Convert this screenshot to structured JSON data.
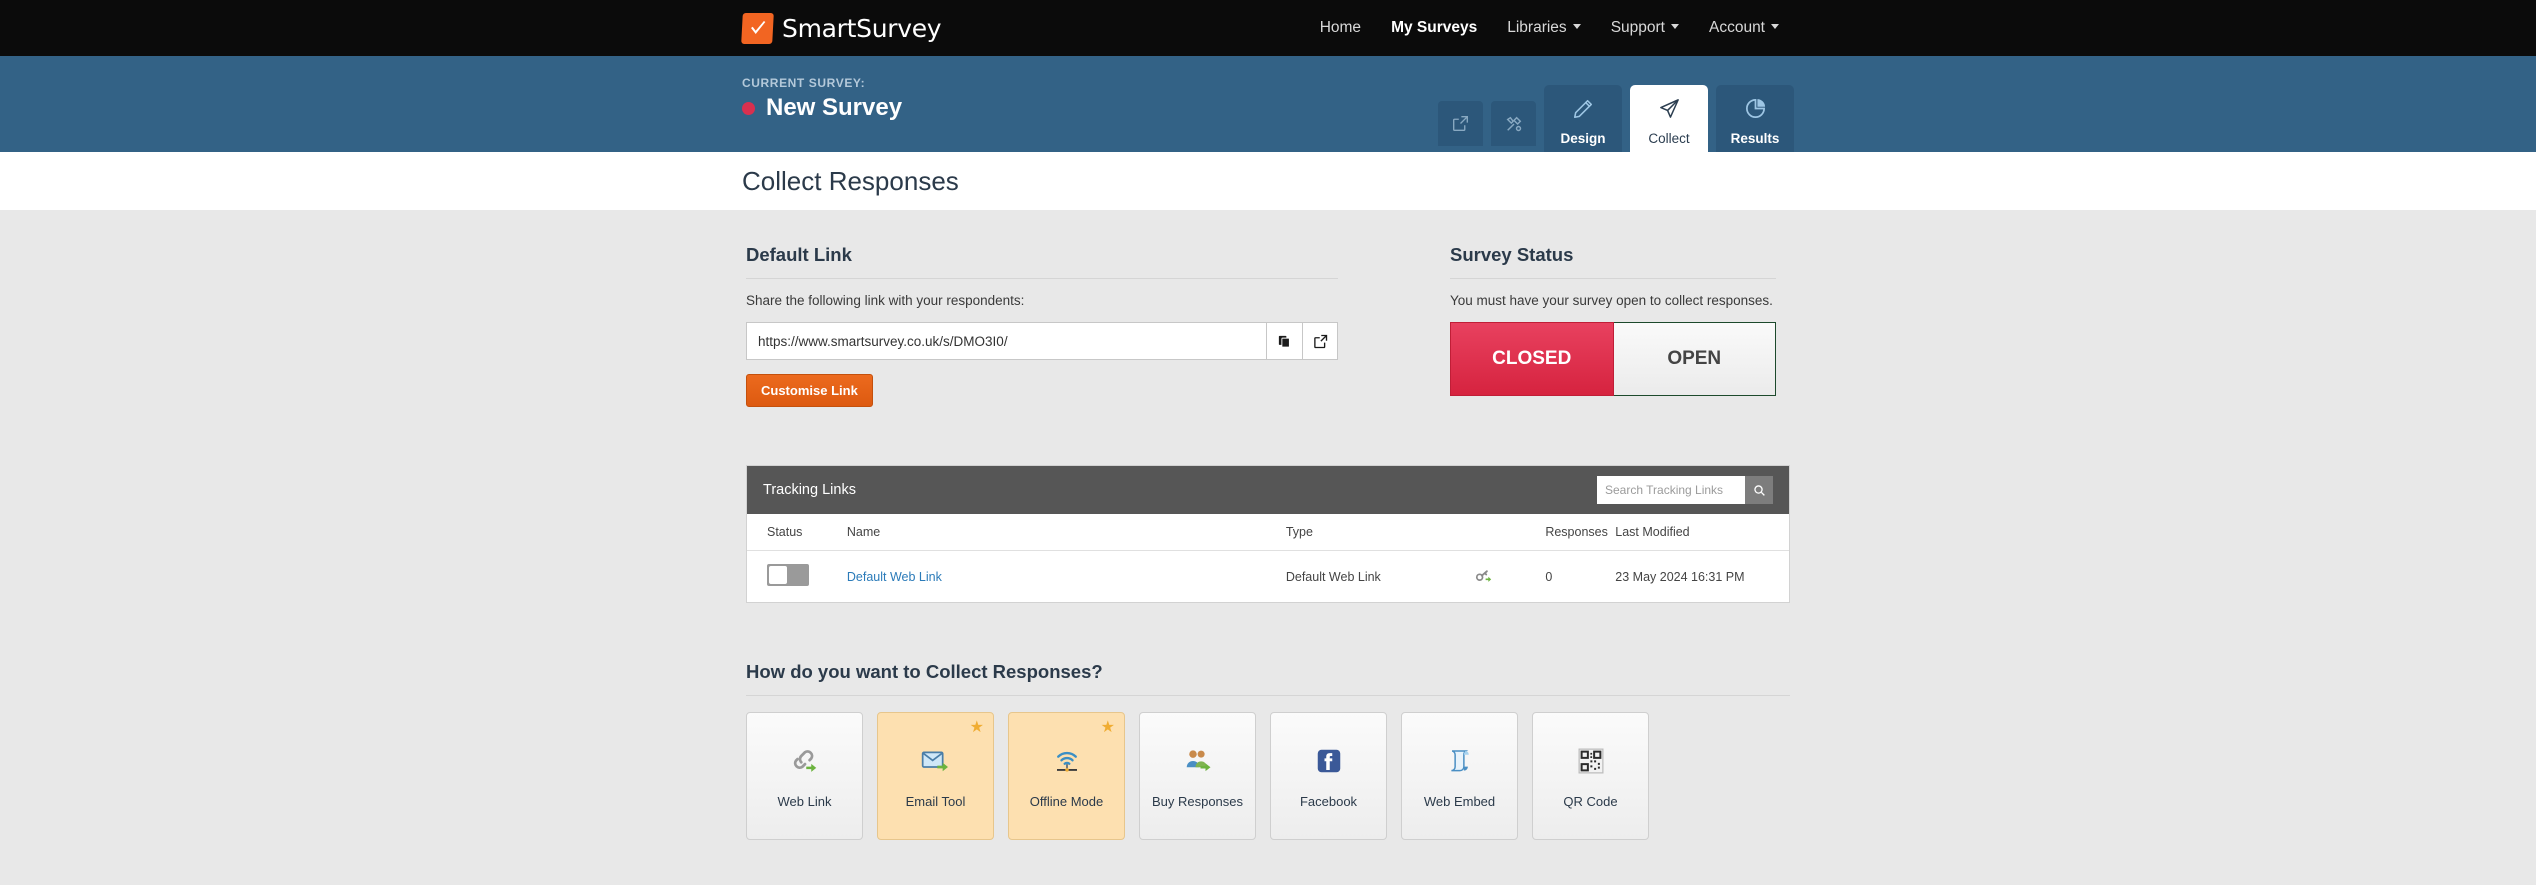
{
  "topnav": {
    "brand": "SmartSurvey",
    "links": [
      {
        "label": "Home",
        "active": false
      },
      {
        "label": "My Surveys",
        "active": true
      },
      {
        "label": "Libraries",
        "active": false,
        "caret": true
      },
      {
        "label": "Support",
        "active": false,
        "caret": true
      },
      {
        "label": "Account",
        "active": false,
        "caret": true
      }
    ]
  },
  "surveybar": {
    "kicker": "CURRENT SURVEY:",
    "name": "New Survey",
    "status_dot_color": "#d9304f",
    "icon_buttons": [
      {
        "name": "preview-survey-button",
        "icon": "external-link-icon"
      },
      {
        "name": "survey-tools-button",
        "icon": "tools-icon"
      }
    ],
    "tabs": [
      {
        "label": "Design",
        "icon": "pencil-icon",
        "active": false
      },
      {
        "label": "Collect",
        "icon": "paper-plane-icon",
        "active": true
      },
      {
        "label": "Results",
        "icon": "pie-chart-icon",
        "active": false
      }
    ]
  },
  "page": {
    "title": "Collect Responses"
  },
  "default_link": {
    "heading": "Default Link",
    "description": "Share the following link with your respondents:",
    "url": "https://www.smartsurvey.co.uk/s/DMO3I0/",
    "copy_icon": "copy-icon",
    "open_icon": "external-link-icon",
    "customise_button": "Customise Link",
    "accent_color": "#e0600f"
  },
  "survey_status": {
    "heading": "Survey Status",
    "description": "You must have your survey open to collect responses.",
    "closed_label": "CLOSED",
    "open_label": "OPEN",
    "selected": "CLOSED",
    "closed_color": "#d6233f",
    "open_border_color": "#1d4a2c"
  },
  "tracking_links": {
    "panel_title": "Tracking Links",
    "search_placeholder": "Search Tracking Links",
    "search_value": "",
    "columns": [
      "Status",
      "Name",
      "Type",
      "",
      "Responses",
      "Last Modified"
    ],
    "rows": [
      {
        "status_enabled": false,
        "name": "Default Web Link",
        "type": "Default Web Link",
        "icon": "key-add-icon",
        "responses": "0",
        "last_modified": "23 May 2024 16:31 PM"
      }
    ]
  },
  "collect_options": {
    "heading": "How do you want to Collect Responses?",
    "tiles": [
      {
        "label": "Web Link",
        "icon": "chain-link-icon",
        "featured": false
      },
      {
        "label": "Email Tool",
        "icon": "envelope-icon",
        "featured": true
      },
      {
        "label": "Offline Mode",
        "icon": "wifi-offline-icon",
        "featured": true
      },
      {
        "label": "Buy Responses",
        "icon": "people-icon",
        "featured": false
      },
      {
        "label": "Facebook",
        "icon": "facebook-icon",
        "featured": false
      },
      {
        "label": "Web Embed",
        "icon": "scroll-icon",
        "featured": false
      },
      {
        "label": "QR Code",
        "icon": "qr-code-icon",
        "featured": false
      }
    ]
  }
}
